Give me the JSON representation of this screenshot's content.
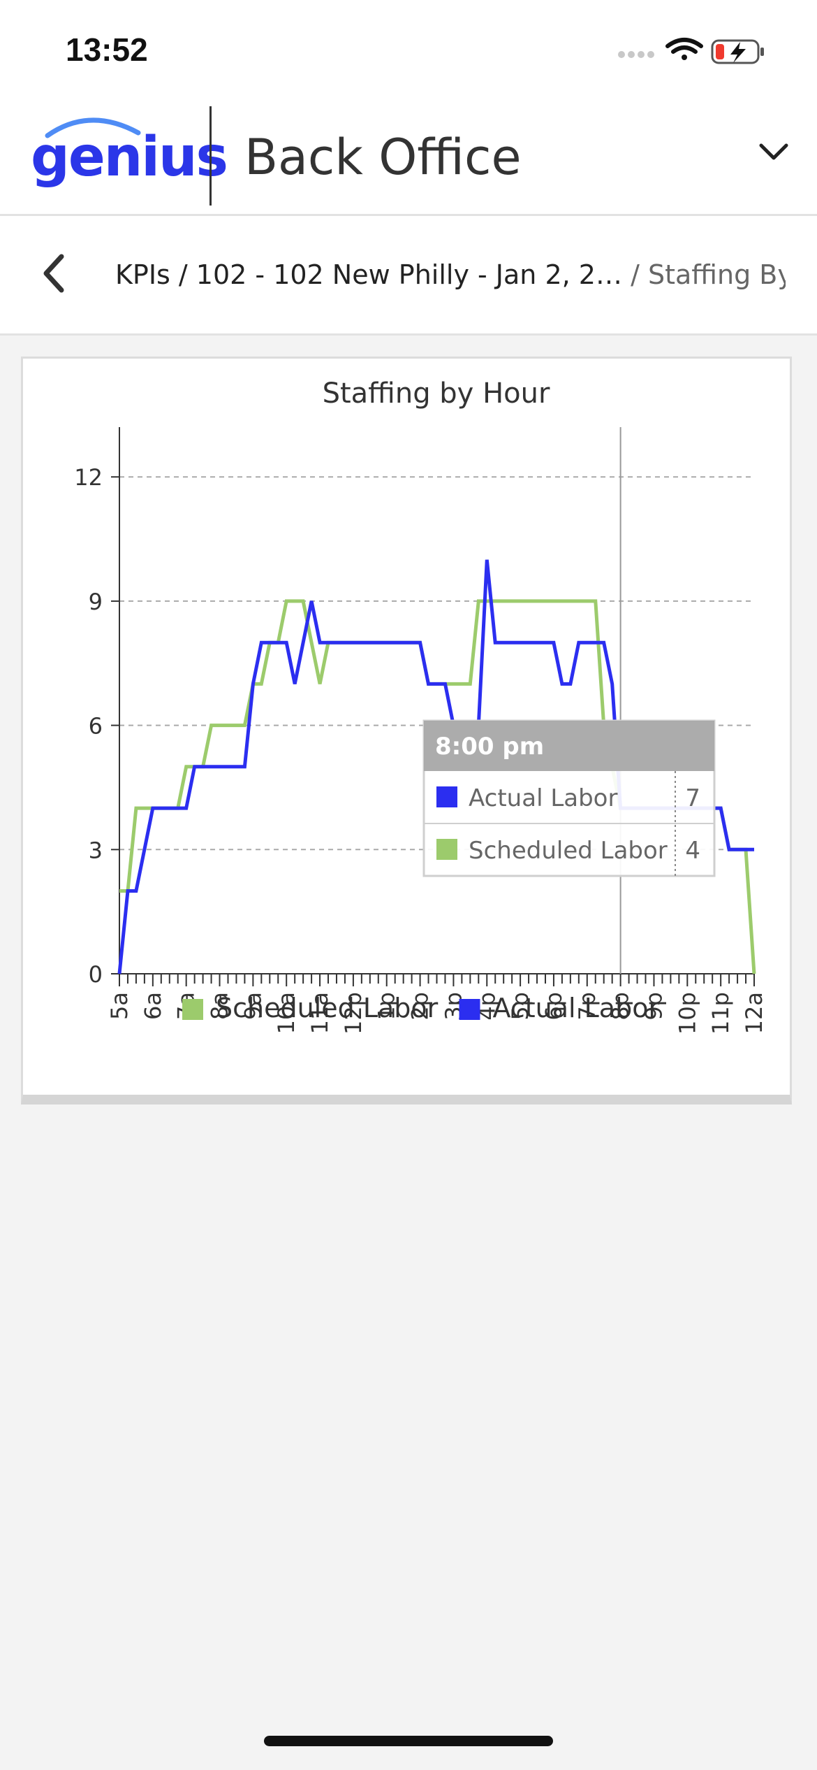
{
  "status_bar": {
    "time": "13:52"
  },
  "header": {
    "logo": "genius",
    "title": "Back Office"
  },
  "breadcrumb": {
    "path": "KPIs / 102 - 102 New Philly - Jan 2, 2… ",
    "current": "/ Staffing By H…"
  },
  "colors": {
    "scheduled": "#9ccb6c",
    "actual": "#2b2ef0",
    "brand": "#2b36e8"
  },
  "chart_data": {
    "type": "line",
    "title": "Staffing by Hour",
    "xlabel": "",
    "ylabel": "",
    "ylim": [
      0,
      13
    ],
    "yticks": [
      0,
      3,
      6,
      9,
      12
    ],
    "xlim": [
      5,
      24
    ],
    "xtick_labels": [
      "5a",
      "6a",
      "7a",
      "8a",
      "9a",
      "10a",
      "11a",
      "12p",
      "1p",
      "2p",
      "3p",
      "4p",
      "5p",
      "6p",
      "7p",
      "8p",
      "9p",
      "10p",
      "11p",
      "12a"
    ],
    "grid": true,
    "legend_position": "bottom",
    "series": [
      {
        "name": "Scheduled Labor",
        "color": "#9ccb6c",
        "points": [
          [
            5,
            2
          ],
          [
            5.25,
            2
          ],
          [
            5.5,
            4
          ],
          [
            6.75,
            4
          ],
          [
            7,
            5
          ],
          [
            7.5,
            5
          ],
          [
            7.75,
            6
          ],
          [
            8.75,
            6
          ],
          [
            9,
            7
          ],
          [
            9.25,
            7
          ],
          [
            9.5,
            8
          ],
          [
            9.75,
            8
          ],
          [
            10,
            9
          ],
          [
            10.5,
            9
          ],
          [
            10.75,
            8
          ],
          [
            11,
            7
          ],
          [
            11.25,
            8
          ],
          [
            13,
            8
          ],
          [
            14,
            8
          ],
          [
            14.25,
            7
          ],
          [
            14.75,
            7
          ],
          [
            15,
            7
          ],
          [
            15.5,
            7
          ],
          [
            15.75,
            9
          ],
          [
            19,
            9
          ],
          [
            19.25,
            9
          ],
          [
            19.5,
            6
          ],
          [
            20,
            4
          ],
          [
            21,
            4
          ],
          [
            22,
            4
          ],
          [
            23,
            4
          ],
          [
            23.25,
            3
          ],
          [
            23.75,
            3
          ],
          [
            24,
            0
          ]
        ]
      },
      {
        "name": "Actual Labor",
        "color": "#2b2ef0",
        "points": [
          [
            5,
            0
          ],
          [
            5.25,
            2
          ],
          [
            5.5,
            2
          ],
          [
            6,
            4
          ],
          [
            6.75,
            4
          ],
          [
            7,
            4
          ],
          [
            7.25,
            5
          ],
          [
            8,
            5
          ],
          [
            8.5,
            5
          ],
          [
            8.75,
            5
          ],
          [
            9,
            7
          ],
          [
            9.25,
            8
          ],
          [
            10,
            8
          ],
          [
            10.25,
            7
          ],
          [
            10.75,
            9
          ],
          [
            11,
            8
          ],
          [
            14,
            8
          ],
          [
            14.25,
            7
          ],
          [
            14.75,
            7
          ],
          [
            15,
            6
          ],
          [
            15.75,
            6
          ],
          [
            16,
            10
          ],
          [
            16.25,
            8
          ],
          [
            18,
            8
          ],
          [
            18.25,
            7
          ],
          [
            18.5,
            7
          ],
          [
            18.75,
            8
          ],
          [
            19.5,
            8
          ],
          [
            19.75,
            7
          ],
          [
            20,
            4
          ],
          [
            23,
            4
          ],
          [
            23.25,
            3
          ],
          [
            24,
            3
          ]
        ]
      }
    ],
    "cursor_x": 20,
    "tooltip": {
      "title": "8:00 pm",
      "rows": [
        {
          "label": "Actual Labor",
          "value": "7",
          "color": "#2b2ef0"
        },
        {
          "label": "Scheduled Labor",
          "value": "4",
          "color": "#9ccb6c"
        }
      ]
    },
    "legend": [
      {
        "label": "Scheduled Labor",
        "color": "#9ccb6c"
      },
      {
        "label": "Actual Labor",
        "color": "#2b2ef0"
      }
    ]
  }
}
